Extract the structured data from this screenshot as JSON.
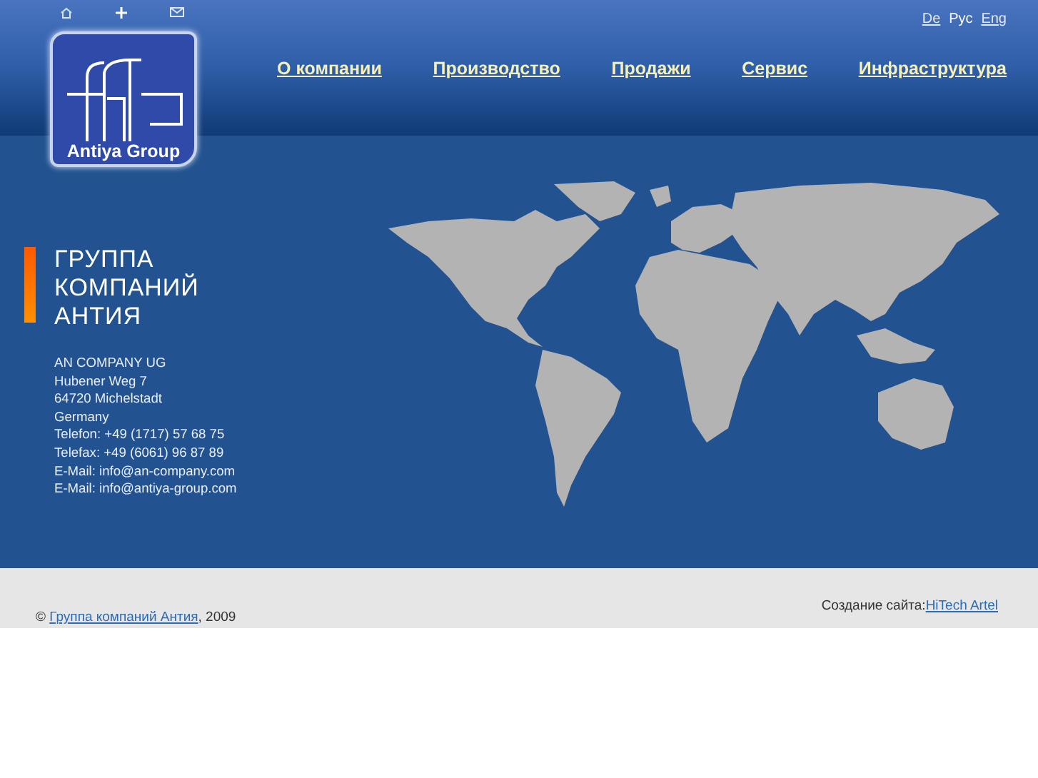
{
  "languages": [
    {
      "label": "De",
      "selected": false
    },
    {
      "label": "Рус",
      "selected": true
    },
    {
      "label": "Eng",
      "selected": false
    }
  ],
  "logo": {
    "text": "Antiya Group"
  },
  "nav": [
    "О компании",
    "Производство",
    "Продажи",
    "Сервис",
    "Инфраструктура"
  ],
  "heading": "ГРУППА КОМПАНИЙ АНТИЯ",
  "address": [
    "AN COMPANY UG",
    "Hubener Weg 7",
    "64720 Michelstadt",
    "Germany",
    "Telefon: +49 (1717) 57 68 75",
    "Telefax: +49 (6061) 96 87 89",
    "E-Mail: info@an-company.com",
    "E-Mail: info@antiya-group.com"
  ],
  "footer": {
    "copyright_prefix": "©",
    "copyright_link": "Группа компаний Антия",
    "copyright_suffix": ", 2009",
    "credit_label": "Создание сайта:",
    "credit_link": "HiTech Artel"
  }
}
